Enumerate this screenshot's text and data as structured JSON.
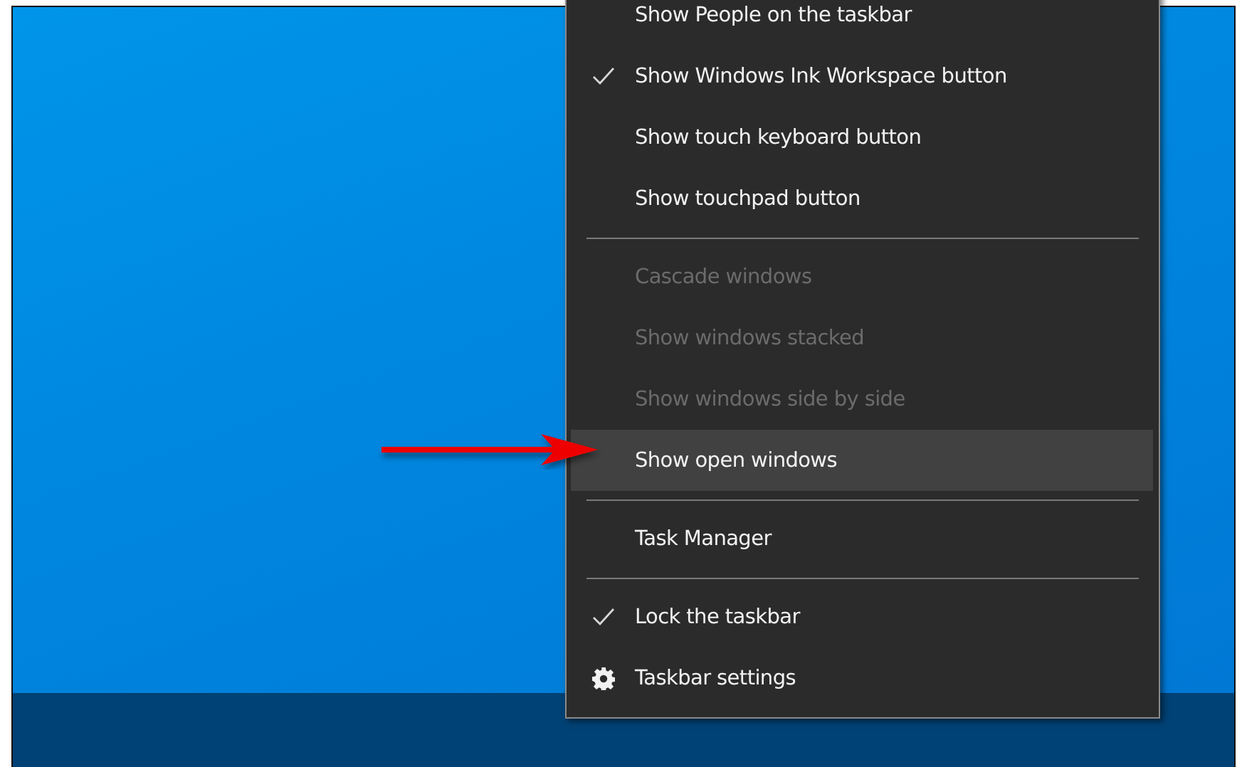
{
  "context_menu": {
    "items": [
      {
        "kind": "option",
        "label": "Show People on the taskbar",
        "checked": false,
        "disabled": false,
        "selected": false
      },
      {
        "kind": "option",
        "label": "Show Windows Ink Workspace button",
        "checked": true,
        "disabled": false,
        "selected": false
      },
      {
        "kind": "option",
        "label": "Show touch keyboard button",
        "checked": false,
        "disabled": false,
        "selected": false
      },
      {
        "kind": "option",
        "label": "Show touchpad button",
        "checked": false,
        "disabled": false,
        "selected": false
      },
      {
        "kind": "separator"
      },
      {
        "kind": "option",
        "label": "Cascade windows",
        "checked": false,
        "disabled": true,
        "selected": false
      },
      {
        "kind": "option",
        "label": "Show windows stacked",
        "checked": false,
        "disabled": true,
        "selected": false
      },
      {
        "kind": "option",
        "label": "Show windows side by side",
        "checked": false,
        "disabled": true,
        "selected": false
      },
      {
        "kind": "option",
        "label": "Show open windows",
        "checked": false,
        "disabled": false,
        "selected": true
      },
      {
        "kind": "separator"
      },
      {
        "kind": "option",
        "label": "Task Manager",
        "checked": false,
        "disabled": false,
        "selected": false
      },
      {
        "kind": "separator"
      },
      {
        "kind": "option",
        "label": "Lock the taskbar",
        "checked": true,
        "disabled": false,
        "selected": false
      },
      {
        "kind": "settings",
        "label": "Taskbar settings",
        "disabled": false,
        "selected": false
      }
    ]
  }
}
